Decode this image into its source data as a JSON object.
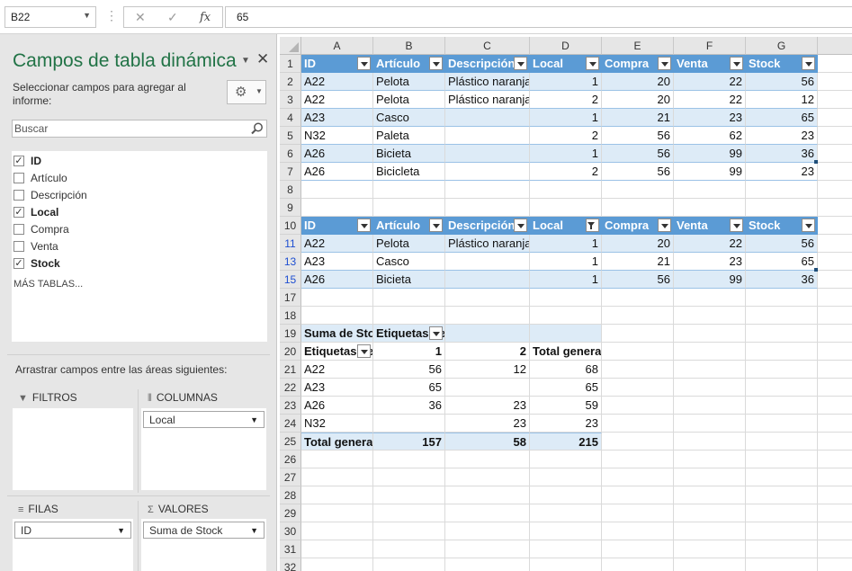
{
  "formula_bar": {
    "name_box": "B22",
    "cancel_glyph": "✕",
    "enter_glyph": "✓",
    "fx_label": "fx",
    "value": "65"
  },
  "pivot_pane": {
    "title": "Campos de tabla dinámica",
    "close_glyph": "✕",
    "instruction": "Seleccionar campos para agregar al informe:",
    "search_placeholder": "Buscar",
    "fields": [
      {
        "label": "ID",
        "checked": true
      },
      {
        "label": "Artículo",
        "checked": false
      },
      {
        "label": "Descripción",
        "checked": false
      },
      {
        "label": "Local",
        "checked": true
      },
      {
        "label": "Compra",
        "checked": false
      },
      {
        "label": "Venta",
        "checked": false
      },
      {
        "label": "Stock",
        "checked": true
      }
    ],
    "more_tables": "MÁS TABLAS...",
    "areas_instruction": "Arrastrar campos entre las áreas siguientes:",
    "areas": {
      "filters": {
        "label": "FILTROS",
        "icon": "filter-icon",
        "items": []
      },
      "columns": {
        "label": "COLUMNAS",
        "icon": "columns-icon",
        "items": [
          "Local"
        ]
      },
      "rows": {
        "label": "FILAS",
        "icon": "rows-icon",
        "items": [
          "ID"
        ]
      },
      "values": {
        "label": "VALORES",
        "icon": "sigma-icon",
        "items": [
          "Suma de Stock"
        ]
      }
    }
  },
  "sheet": {
    "columns": [
      "A",
      "B",
      "C",
      "D",
      "E",
      "F",
      "G"
    ],
    "rows": [
      {
        "num": "1",
        "cells": [
          "ID",
          "Artículo",
          "Descripción",
          "Local",
          "Compra",
          "Venta",
          "Stock"
        ]
      },
      {
        "num": "2",
        "cells": [
          "A22",
          "Pelota",
          "Plástico naranja",
          "1",
          "20",
          "22",
          "56"
        ]
      },
      {
        "num": "3",
        "cells": [
          "A22",
          "Pelota",
          "Plástico naranja",
          "2",
          "20",
          "22",
          "12"
        ]
      },
      {
        "num": "4",
        "cells": [
          "A23",
          "Casco",
          "",
          "1",
          "21",
          "23",
          "65"
        ]
      },
      {
        "num": "5",
        "cells": [
          "N32",
          "Paleta",
          "",
          "2",
          "56",
          "62",
          "23"
        ]
      },
      {
        "num": "6",
        "cells": [
          "A26",
          "Bicieta",
          "",
          "1",
          "56",
          "99",
          "36"
        ]
      },
      {
        "num": "7",
        "cells": [
          "A26",
          "Bicicleta",
          "",
          "2",
          "56",
          "99",
          "23"
        ]
      },
      {
        "num": "8",
        "cells": [
          "",
          "",
          "",
          "",
          "",
          "",
          ""
        ]
      },
      {
        "num": "9",
        "cells": [
          "",
          "",
          "",
          "",
          "",
          "",
          ""
        ]
      },
      {
        "num": "10",
        "cells": [
          "ID",
          "Artículo",
          "Descripción",
          "Local",
          "Compra",
          "Venta",
          "Stock"
        ]
      },
      {
        "num": "11",
        "cells": [
          "A22",
          "Pelota",
          "Plástico naranja",
          "1",
          "20",
          "22",
          "56"
        ]
      },
      {
        "num": "13",
        "cells": [
          "A23",
          "Casco",
          "",
          "1",
          "21",
          "23",
          "65"
        ]
      },
      {
        "num": "15",
        "cells": [
          "A26",
          "Bicieta",
          "",
          "1",
          "56",
          "99",
          "36"
        ]
      },
      {
        "num": "17",
        "cells": [
          "",
          "",
          "",
          "",
          "",
          "",
          ""
        ]
      },
      {
        "num": "18",
        "cells": [
          "",
          "",
          "",
          "",
          "",
          "",
          ""
        ]
      },
      {
        "num": "19",
        "cells": [
          "Suma de Stock",
          "Etiquetas de columna",
          "",
          "",
          "",
          "",
          ""
        ]
      },
      {
        "num": "20",
        "cells": [
          "Etiquetas de fila",
          "1",
          "2",
          "Total general",
          "",
          "",
          ""
        ]
      },
      {
        "num": "21",
        "cells": [
          "A22",
          "56",
          "12",
          "68",
          "",
          "",
          ""
        ]
      },
      {
        "num": "22",
        "cells": [
          "A23",
          "65",
          "",
          "65",
          "",
          "",
          ""
        ]
      },
      {
        "num": "23",
        "cells": [
          "A26",
          "36",
          "23",
          "59",
          "",
          "",
          ""
        ]
      },
      {
        "num": "24",
        "cells": [
          "N32",
          "",
          "23",
          "23",
          "",
          "",
          ""
        ]
      },
      {
        "num": "25",
        "cells": [
          "Total general",
          "157",
          "58",
          "215",
          "",
          "",
          ""
        ]
      },
      {
        "num": "26",
        "cells": [
          "",
          "",
          "",
          "",
          "",
          "",
          ""
        ]
      },
      {
        "num": "27",
        "cells": [
          "",
          "",
          "",
          "",
          "",
          "",
          ""
        ]
      },
      {
        "num": "28",
        "cells": [
          "",
          "",
          "",
          "",
          "",
          "",
          ""
        ]
      },
      {
        "num": "29",
        "cells": [
          "",
          "",
          "",
          "",
          "",
          "",
          ""
        ]
      },
      {
        "num": "30",
        "cells": [
          "",
          "",
          "",
          "",
          "",
          "",
          ""
        ]
      },
      {
        "num": "31",
        "cells": [
          "",
          "",
          "",
          "",
          "",
          "",
          ""
        ]
      },
      {
        "num": "32",
        "cells": [
          "",
          "",
          "",
          "",
          "",
          "",
          ""
        ]
      }
    ]
  },
  "colors": {
    "accent": "#217346",
    "table_header": "#5b9bd5",
    "table_band": "#ddebf7",
    "filtered_row_number": "#1f4fd1"
  }
}
